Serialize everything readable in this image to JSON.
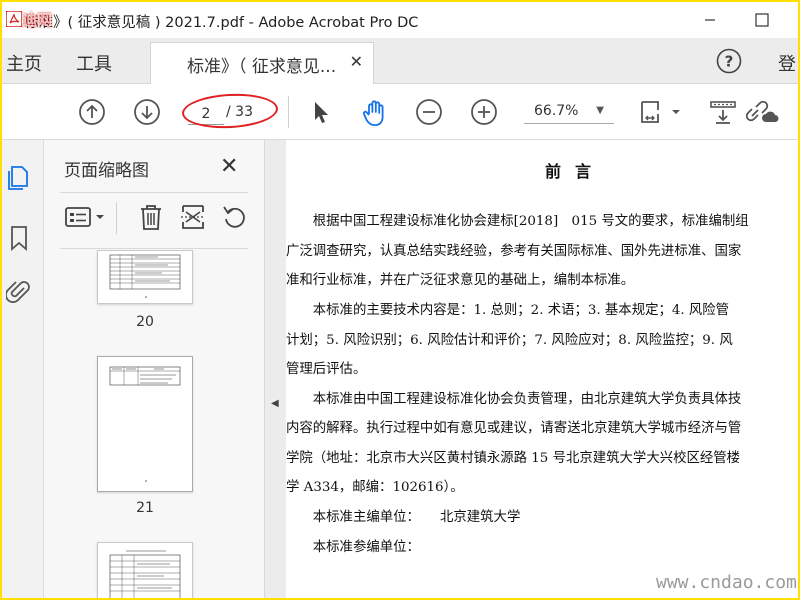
{
  "window": {
    "title": "标准》( 征求意见稿 ) 2021.7.pdf - Adobe Acrobat Pro DC",
    "title_watermark": "迪网"
  },
  "tabs": {
    "home": "主页",
    "tools": "工具",
    "document_tab": "标准》（ 征求意见...",
    "signin": "登"
  },
  "toolbar": {
    "current_page": "2",
    "total_pages": "/ 33",
    "zoom": "66.7%"
  },
  "thumbnail_panel": {
    "title": "页面缩略图",
    "thumbnails": [
      {
        "label": "20"
      },
      {
        "label": "21"
      }
    ]
  },
  "document": {
    "heading": "前言",
    "lines": [
      "　　根据中国工程建设标准化协会建标[2018]　015 号文的要求，标准编制组",
      "广泛调查研究，认真总结实践经验，参考有关国际标准、国外先进标准、国家",
      "准和行业标准，并在广泛征求意见的基础上，编制本标准。",
      "　　本标准的主要技术内容是：1. 总则；2. 术语；3. 基本规定；4. 风险管",
      "计划；5. 风险识别；6. 风险估计和评价；7. 风险应对；8. 风险监控；9. 风",
      "管理后评估。",
      "　　本标准由中国工程建设标准化协会负责管理，由北京建筑大学负责具体技",
      "内容的解释。执行过程中如有意见或建议，请寄送北京建筑大学城市经济与管",
      "学院（地址：北京市大兴区黄村镇永源路 15 号北京建筑大学大兴校区经管楼",
      "学 A334，邮编：102616）。",
      "　　本标准主编单位：　　北京建筑大学",
      "　　本标准参编单位："
    ]
  },
  "watermark": "www.cndao.com",
  "colors": {
    "border_yellow": "#ffe000",
    "annotation_red": "#e02020",
    "acrobat_red": "#d7291f",
    "active_icon_blue": "#1473e6"
  }
}
